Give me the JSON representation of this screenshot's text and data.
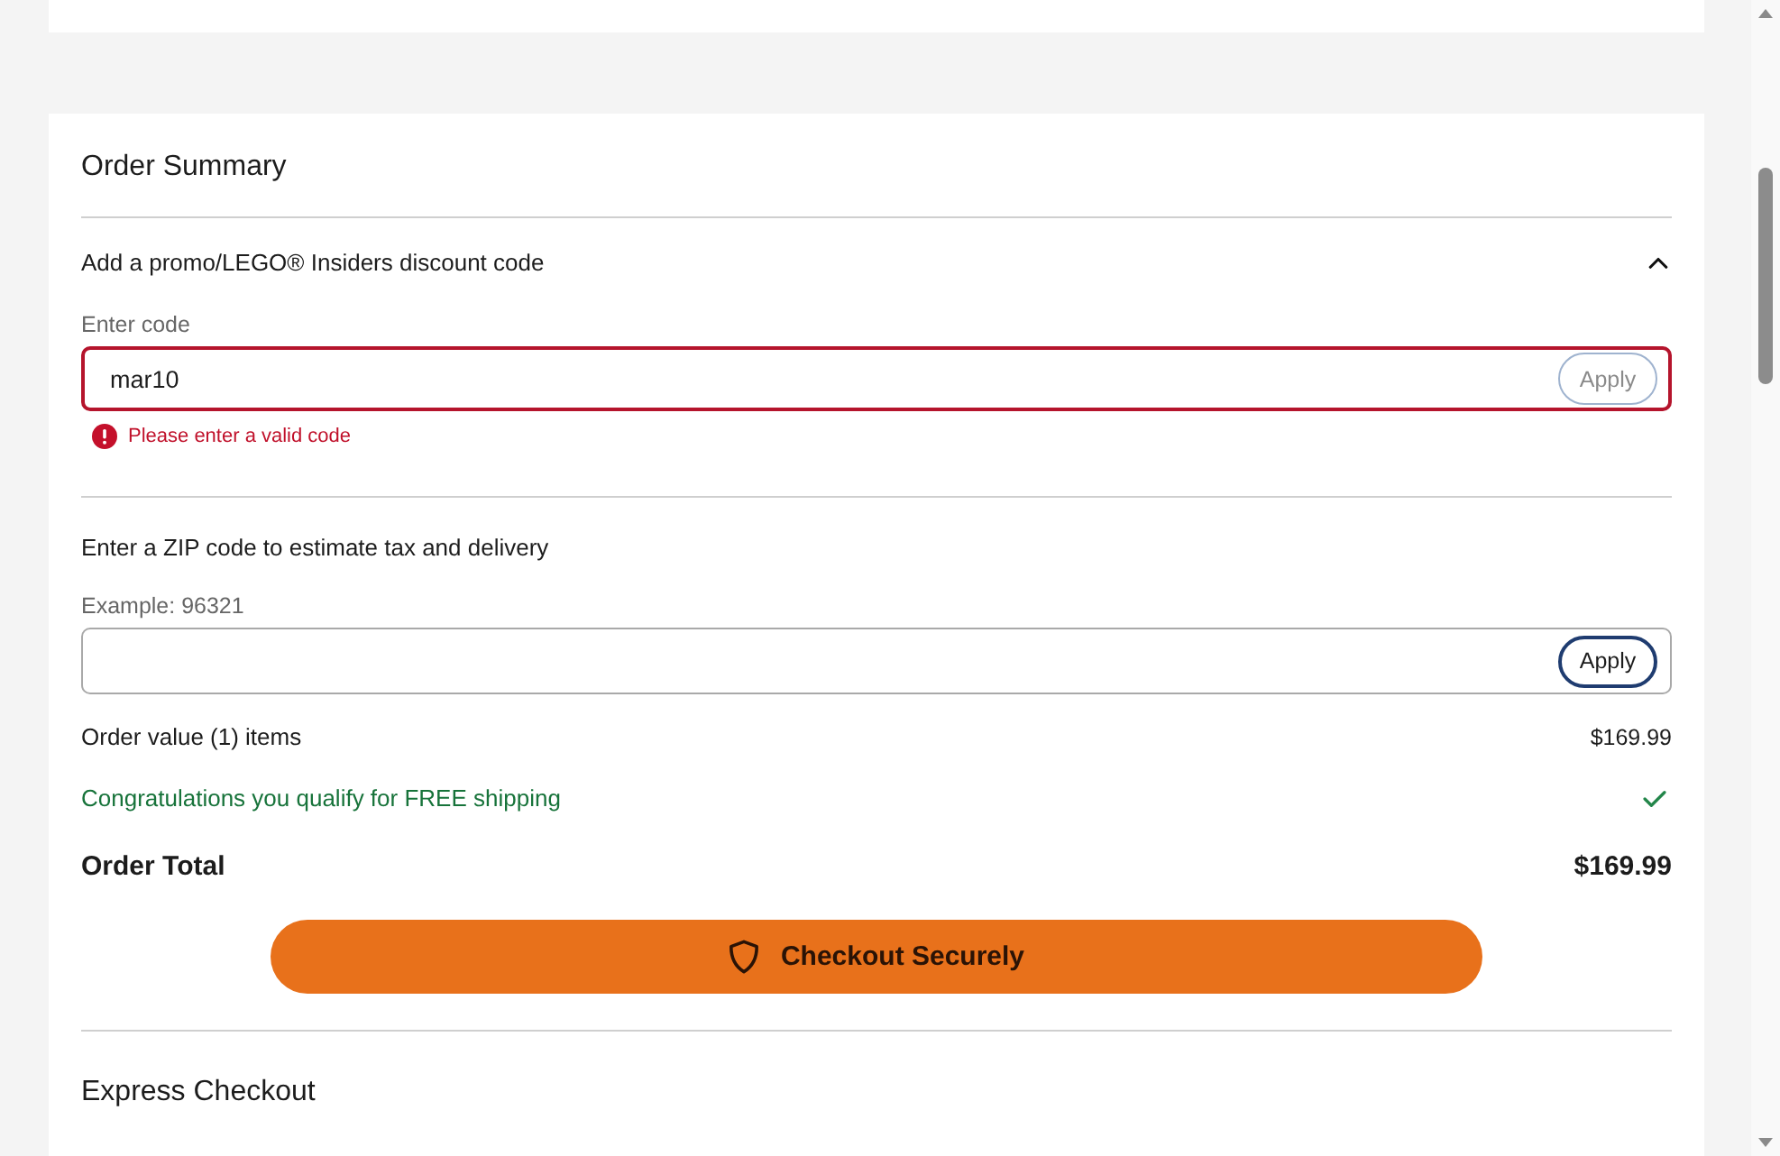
{
  "order_summary": {
    "title": "Order Summary",
    "promo": {
      "label": "Add a promo/LEGO® Insiders discount code",
      "expanded": true,
      "field_label": "Enter code",
      "value": "mar10",
      "invalid": true,
      "error": "Please enter a valid code",
      "apply": {
        "label": "Apply",
        "disabled": true
      }
    },
    "zip": {
      "heading": "Enter a ZIP code to estimate tax and delivery",
      "field_label": "Example: 96321",
      "apply": {
        "label": "Apply",
        "disabled": false
      }
    },
    "lines": [
      {
        "kind": "amount",
        "label": "Order value (1) items",
        "value": "$169.99"
      },
      {
        "kind": "notice",
        "label": "Congratulations you qualify for FREE shipping"
      },
      {
        "kind": "total",
        "label": "Order Total",
        "value": "$169.99"
      }
    ],
    "checkout_button": "Checkout Securely",
    "express_checkout": {
      "title": "Express Checkout"
    }
  }
}
